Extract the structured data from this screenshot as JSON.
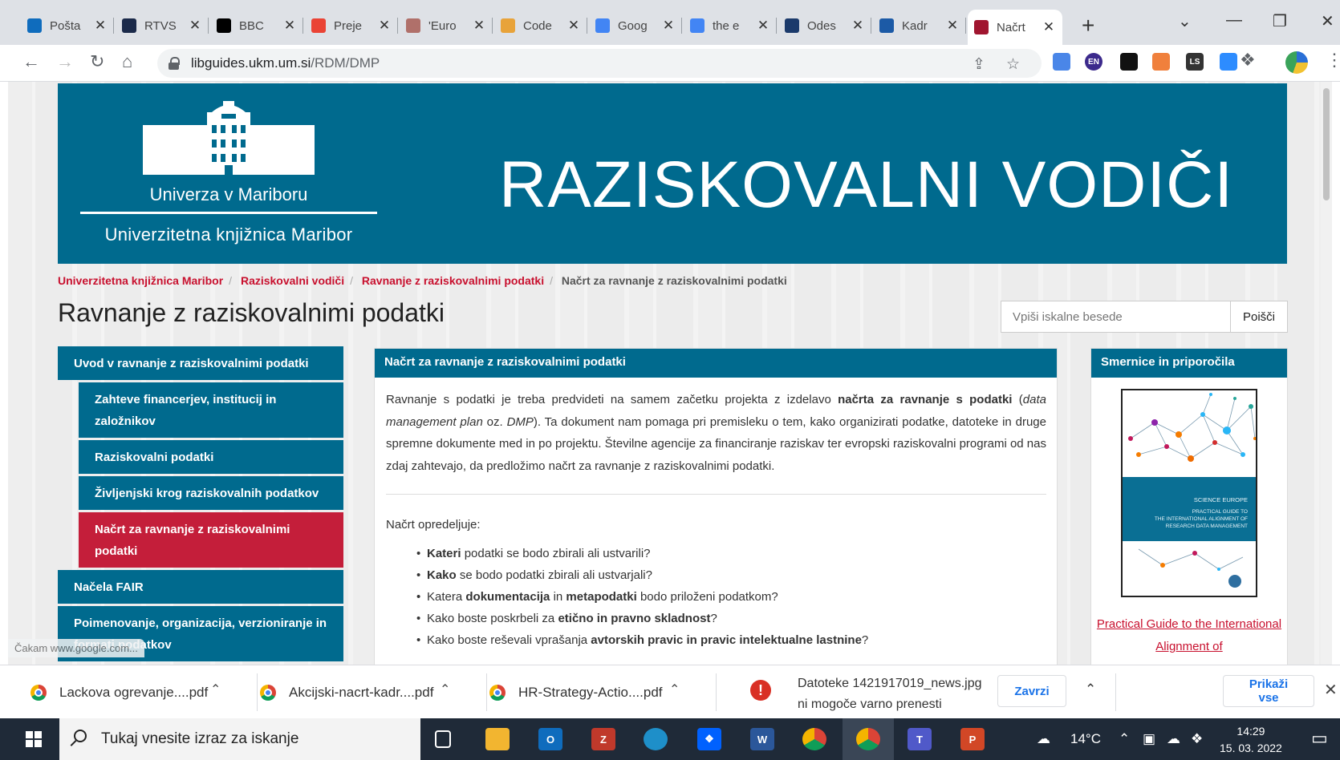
{
  "browser": {
    "tabs": [
      {
        "title": "Pošta",
        "fav_color": "#0f6cbd",
        "fav_icon": "outlook-icon"
      },
      {
        "title": "RTVS",
        "fav_color": "#1b2a4a",
        "fav_icon": "rtvslo-icon"
      },
      {
        "title": "BBC",
        "fav_color": "#000000",
        "fav_icon": "bbc-icon"
      },
      {
        "title": "Preje",
        "fav_color": "#ea4335",
        "fav_icon": "gmail-icon"
      },
      {
        "title": "'Euro",
        "fav_color": "#b0706a",
        "fav_icon": "euro-icon"
      },
      {
        "title": "Code",
        "fav_color": "#e8a33a",
        "fav_icon": "code-icon"
      },
      {
        "title": "Goog",
        "fav_color": "#4285f4",
        "fav_icon": "google-translate-icon"
      },
      {
        "title": "the e",
        "fav_color": "#4285f4",
        "fav_icon": "google-icon"
      },
      {
        "title": "Odes",
        "fav_color": "#1b3a6b",
        "fav_icon": "odes-icon"
      },
      {
        "title": "Kadr",
        "fav_color": "#1c5aa6",
        "fav_icon": "kadr-icon"
      },
      {
        "title": "Načrt",
        "fav_color": "#a0152f",
        "fav_icon": "um-icon"
      }
    ],
    "url_host": "libguides.ukm.um.si",
    "url_path": "/RDM/DMP",
    "extensions": [
      {
        "label": "",
        "color": "#4a86e8"
      },
      {
        "label": "EN",
        "color": "#3c2a8c"
      },
      {
        "label": "",
        "color": "#111111"
      },
      {
        "label": "",
        "color": "#f0803c"
      },
      {
        "label": "LS",
        "color": "#333333"
      },
      {
        "label": "",
        "color": "#2d8cff"
      },
      {
        "label": "",
        "color": "#5f6368"
      }
    ]
  },
  "site": {
    "university": "Univerza v Mariboru",
    "library": "Univerzitetna knjižnica Maribor",
    "banner_title": "RAZISKOVALNI VODIČI",
    "breadcrumbs": [
      "Univerzitetna knjižnica Maribor",
      "Raziskovalni vodiči",
      "Ravnanje z raziskovalnimi podatki"
    ],
    "breadcrumb_current": "Načrt za ravnanje z raziskovalnimi podatki",
    "page_title": "Ravnanje z raziskovalnimi podatki",
    "search_placeholder": "Vpiši iskalne besede",
    "search_button": "Poišči",
    "nav": [
      {
        "label": "Uvod v ravnanje z raziskovalnimi podatki",
        "sub": false,
        "active": false
      },
      {
        "label": "Zahteve financerjev, institucij in založnikov",
        "sub": true,
        "active": false
      },
      {
        "label": "Raziskovalni podatki",
        "sub": true,
        "active": false
      },
      {
        "label": "Življenjski krog raziskovalnih podatkov",
        "sub": true,
        "active": false
      },
      {
        "label": "Načrt za ravnanje z raziskovalnimi podatki",
        "sub": true,
        "active": true
      },
      {
        "label": "Načela FAIR",
        "sub": false,
        "active": false
      },
      {
        "label": "Poimenovanje, organizacija, verzioniranje in formati podatkov",
        "sub": false,
        "active": false
      }
    ],
    "main_panel": {
      "title": "Načrt za ravnanje z raziskovalnimi podatki",
      "intro_1": "Ravnanje s podatki je treba predvideti na samem začetku projekta z izdelavo ",
      "intro_bold": "načrta za ravnanje s podatki",
      "intro_2": " (",
      "intro_italic_1": "data management plan",
      "intro_3": " oz. ",
      "intro_italic_2": "DMP",
      "intro_4": "). Ta dokument nam pomaga pri premisleku o tem, kako organizirati podatke, datoteke in druge spremne dokumente med in po projektu. Številne agencije za financiranje raziskav ter evropski raziskovalni programi od nas zdaj zahtevajo, da predložimo načrt za ravnanje z raziskovalnimi podatki.",
      "list_intro": "Načrt opredeljuje:",
      "items": [
        {
          "b1": "Kateri",
          "t1": " podatki se bodo zbirali ali ustvarili?",
          "b2": "",
          "t2": "",
          "b3": "",
          "t3": ""
        },
        {
          "b1": "Kako",
          "t1": " se bodo podatki zbirali ali ustvarjali?",
          "b2": "",
          "t2": "",
          "b3": "",
          "t3": ""
        },
        {
          "b1": "",
          "t1": "Katera ",
          "b2": "dokumentacija",
          "t2": " in ",
          "b3": "metapodatki",
          "t3": " bodo priloženi podatkom?"
        },
        {
          "b1": "",
          "t1": "Kako boste poskrbeli za ",
          "b2": "etično in pravno skladnost",
          "t2": "?",
          "b3": "",
          "t3": ""
        },
        {
          "b1": "",
          "t1": "Kako boste reševali vprašanja ",
          "b2": "avtorskih pravic in pravic intelektualne lastnine",
          "t2": "?",
          "b3": "",
          "t3": ""
        }
      ]
    },
    "side_panel": {
      "title": "Smernice in priporočila",
      "book_publisher": "SCIENCE EUROPE",
      "book_line1": "PRACTICAL GUIDE TO",
      "book_line2": "THE INTERNATIONAL ALIGNMENT OF",
      "book_line3": "RESEARCH DATA MANAGEMENT",
      "link_text": "Practical Guide to the International Alignment of"
    },
    "status_text": "Čakam www.google.com..."
  },
  "downloads": {
    "items": [
      "Lackova ogrevanje....pdf",
      "Akcijski-nacrt-kadr....pdf",
      "HR-Strategy-Actio....pdf"
    ],
    "warning_line1": "Datoteke 1421917019_news.jpg",
    "warning_line2": "ni mogoče varno prenesti",
    "discard_button": "Zavrzi",
    "show_all_button": "Prikaži vse"
  },
  "taskbar": {
    "search_placeholder": "Tukaj vnesite izraz za iskanje",
    "temperature": "14°C",
    "time": "14:29",
    "date": "15. 03. 2022"
  }
}
